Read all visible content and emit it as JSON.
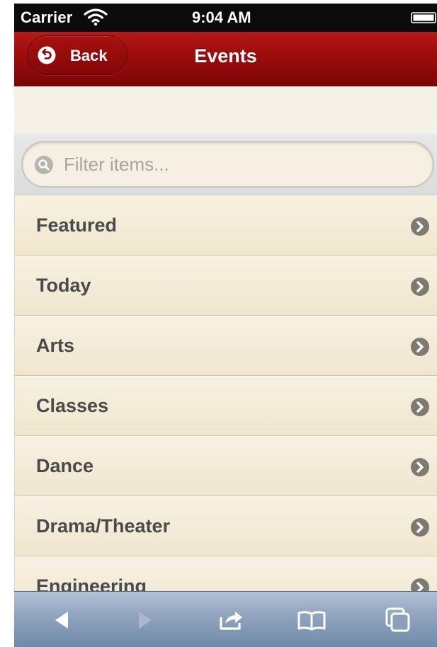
{
  "status_bar": {
    "carrier": "Carrier",
    "time": "9:04 AM",
    "wifi_icon": "wifi-icon",
    "battery_icon": "battery-icon"
  },
  "nav_bar": {
    "back_label": "Back",
    "title": "Events",
    "color": "#9c0c0c"
  },
  "search": {
    "placeholder": "Filter items..."
  },
  "list": {
    "items": [
      {
        "label": "Featured"
      },
      {
        "label": "Today"
      },
      {
        "label": "Arts"
      },
      {
        "label": "Classes"
      },
      {
        "label": "Dance"
      },
      {
        "label": "Drama/Theater"
      },
      {
        "label": "Engineering"
      }
    ]
  },
  "toolbar": {
    "buttons": [
      "back-arrow-icon",
      "forward-arrow-icon",
      "share-icon",
      "bookmarks-icon",
      "tabs-icon"
    ]
  }
}
